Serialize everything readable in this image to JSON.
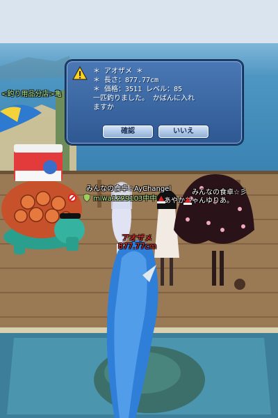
{
  "dialog": {
    "lines": [
      "＊ アオザメ ＊",
      "＊ 長さ：877.77cm",
      "＊ 価格：3511 レベル：85",
      "一匹釣りました。 かばんに入れ",
      "ますか"
    ],
    "confirm_label": "確認",
    "cancel_label": "いいえ"
  },
  "world": {
    "shop_sign": "<釣り用品分店>亀",
    "guild_left": "みんなの食卓☆AyChangel",
    "guild_right": "みんなの食卓☆彡",
    "player_left": "miwa1229103中中",
    "player_right": "あやかちゃんゆりあ。",
    "catch_name": "アオザメ",
    "catch_length": "877.77cm"
  },
  "colors": {
    "dialog_bg": "#3a66a3",
    "tag_white": "#ffffff",
    "tag_green": "#b8f08a",
    "catch_red": "#ff2a2a"
  }
}
